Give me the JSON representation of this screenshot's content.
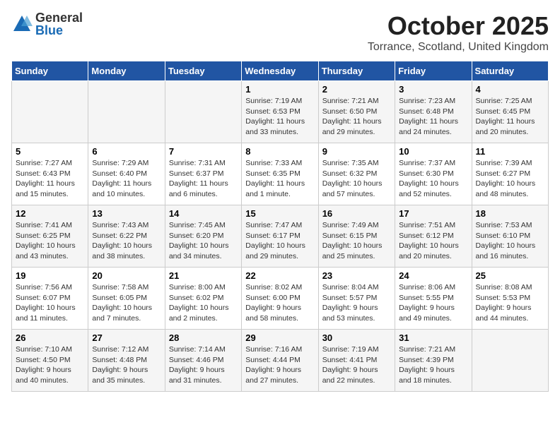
{
  "header": {
    "logo_general": "General",
    "logo_blue": "Blue",
    "title": "October 2025",
    "location": "Torrance, Scotland, United Kingdom"
  },
  "days_of_week": [
    "Sunday",
    "Monday",
    "Tuesday",
    "Wednesday",
    "Thursday",
    "Friday",
    "Saturday"
  ],
  "weeks": [
    [
      {
        "day": "",
        "info": ""
      },
      {
        "day": "",
        "info": ""
      },
      {
        "day": "",
        "info": ""
      },
      {
        "day": "1",
        "info": "Sunrise: 7:19 AM\nSunset: 6:53 PM\nDaylight: 11 hours and 33 minutes."
      },
      {
        "day": "2",
        "info": "Sunrise: 7:21 AM\nSunset: 6:50 PM\nDaylight: 11 hours and 29 minutes."
      },
      {
        "day": "3",
        "info": "Sunrise: 7:23 AM\nSunset: 6:48 PM\nDaylight: 11 hours and 24 minutes."
      },
      {
        "day": "4",
        "info": "Sunrise: 7:25 AM\nSunset: 6:45 PM\nDaylight: 11 hours and 20 minutes."
      }
    ],
    [
      {
        "day": "5",
        "info": "Sunrise: 7:27 AM\nSunset: 6:43 PM\nDaylight: 11 hours and 15 minutes."
      },
      {
        "day": "6",
        "info": "Sunrise: 7:29 AM\nSunset: 6:40 PM\nDaylight: 11 hours and 10 minutes."
      },
      {
        "day": "7",
        "info": "Sunrise: 7:31 AM\nSunset: 6:37 PM\nDaylight: 11 hours and 6 minutes."
      },
      {
        "day": "8",
        "info": "Sunrise: 7:33 AM\nSunset: 6:35 PM\nDaylight: 11 hours and 1 minute."
      },
      {
        "day": "9",
        "info": "Sunrise: 7:35 AM\nSunset: 6:32 PM\nDaylight: 10 hours and 57 minutes."
      },
      {
        "day": "10",
        "info": "Sunrise: 7:37 AM\nSunset: 6:30 PM\nDaylight: 10 hours and 52 minutes."
      },
      {
        "day": "11",
        "info": "Sunrise: 7:39 AM\nSunset: 6:27 PM\nDaylight: 10 hours and 48 minutes."
      }
    ],
    [
      {
        "day": "12",
        "info": "Sunrise: 7:41 AM\nSunset: 6:25 PM\nDaylight: 10 hours and 43 minutes."
      },
      {
        "day": "13",
        "info": "Sunrise: 7:43 AM\nSunset: 6:22 PM\nDaylight: 10 hours and 38 minutes."
      },
      {
        "day": "14",
        "info": "Sunrise: 7:45 AM\nSunset: 6:20 PM\nDaylight: 10 hours and 34 minutes."
      },
      {
        "day": "15",
        "info": "Sunrise: 7:47 AM\nSunset: 6:17 PM\nDaylight: 10 hours and 29 minutes."
      },
      {
        "day": "16",
        "info": "Sunrise: 7:49 AM\nSunset: 6:15 PM\nDaylight: 10 hours and 25 minutes."
      },
      {
        "day": "17",
        "info": "Sunrise: 7:51 AM\nSunset: 6:12 PM\nDaylight: 10 hours and 20 minutes."
      },
      {
        "day": "18",
        "info": "Sunrise: 7:53 AM\nSunset: 6:10 PM\nDaylight: 10 hours and 16 minutes."
      }
    ],
    [
      {
        "day": "19",
        "info": "Sunrise: 7:56 AM\nSunset: 6:07 PM\nDaylight: 10 hours and 11 minutes."
      },
      {
        "day": "20",
        "info": "Sunrise: 7:58 AM\nSunset: 6:05 PM\nDaylight: 10 hours and 7 minutes."
      },
      {
        "day": "21",
        "info": "Sunrise: 8:00 AM\nSunset: 6:02 PM\nDaylight: 10 hours and 2 minutes."
      },
      {
        "day": "22",
        "info": "Sunrise: 8:02 AM\nSunset: 6:00 PM\nDaylight: 9 hours and 58 minutes."
      },
      {
        "day": "23",
        "info": "Sunrise: 8:04 AM\nSunset: 5:57 PM\nDaylight: 9 hours and 53 minutes."
      },
      {
        "day": "24",
        "info": "Sunrise: 8:06 AM\nSunset: 5:55 PM\nDaylight: 9 hours and 49 minutes."
      },
      {
        "day": "25",
        "info": "Sunrise: 8:08 AM\nSunset: 5:53 PM\nDaylight: 9 hours and 44 minutes."
      }
    ],
    [
      {
        "day": "26",
        "info": "Sunrise: 7:10 AM\nSunset: 4:50 PM\nDaylight: 9 hours and 40 minutes."
      },
      {
        "day": "27",
        "info": "Sunrise: 7:12 AM\nSunset: 4:48 PM\nDaylight: 9 hours and 35 minutes."
      },
      {
        "day": "28",
        "info": "Sunrise: 7:14 AM\nSunset: 4:46 PM\nDaylight: 9 hours and 31 minutes."
      },
      {
        "day": "29",
        "info": "Sunrise: 7:16 AM\nSunset: 4:44 PM\nDaylight: 9 hours and 27 minutes."
      },
      {
        "day": "30",
        "info": "Sunrise: 7:19 AM\nSunset: 4:41 PM\nDaylight: 9 hours and 22 minutes."
      },
      {
        "day": "31",
        "info": "Sunrise: 7:21 AM\nSunset: 4:39 PM\nDaylight: 9 hours and 18 minutes."
      },
      {
        "day": "",
        "info": ""
      }
    ]
  ]
}
